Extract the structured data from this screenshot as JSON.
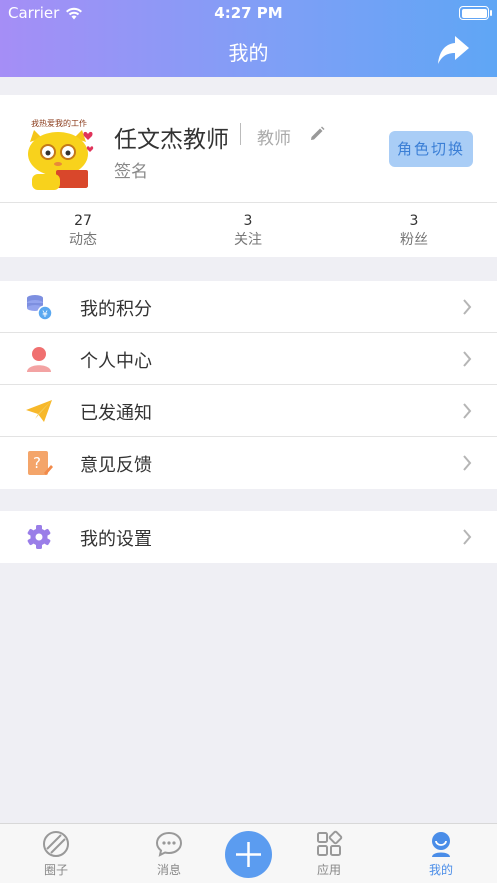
{
  "status_bar": {
    "carrier": "Carrier",
    "time": "4:27 PM"
  },
  "header": {
    "title": "我的"
  },
  "profile": {
    "name": "任文杰教师",
    "role": "教师",
    "signature": "签名",
    "switch_label": "角色切换",
    "avatar_caption": "我热爱我的工作",
    "stats": [
      {
        "value": "27",
        "label": "动态"
      },
      {
        "value": "3",
        "label": "关注"
      },
      {
        "value": "3",
        "label": "粉丝"
      }
    ]
  },
  "menu_group_1": [
    {
      "label": "我的积分",
      "icon": "coins-icon"
    },
    {
      "label": "个人中心",
      "icon": "person-icon"
    },
    {
      "label": "已发通知",
      "icon": "paper-plane-icon"
    },
    {
      "label": "意见反馈",
      "icon": "feedback-icon"
    }
  ],
  "menu_group_2": [
    {
      "label": "我的设置",
      "icon": "gear-icon"
    }
  ],
  "tabbar": {
    "items": [
      {
        "label": "圈子",
        "icon": "circle-icon"
      },
      {
        "label": "消息",
        "icon": "message-icon"
      },
      {
        "label": "",
        "icon": "plus-icon"
      },
      {
        "label": "应用",
        "icon": "apps-icon"
      },
      {
        "label": "我的",
        "icon": "profile-icon",
        "active": true
      }
    ]
  },
  "colors": {
    "accent": "#4a8de8",
    "header_start": "#a58ef6",
    "header_end": "#5fa6f5"
  }
}
